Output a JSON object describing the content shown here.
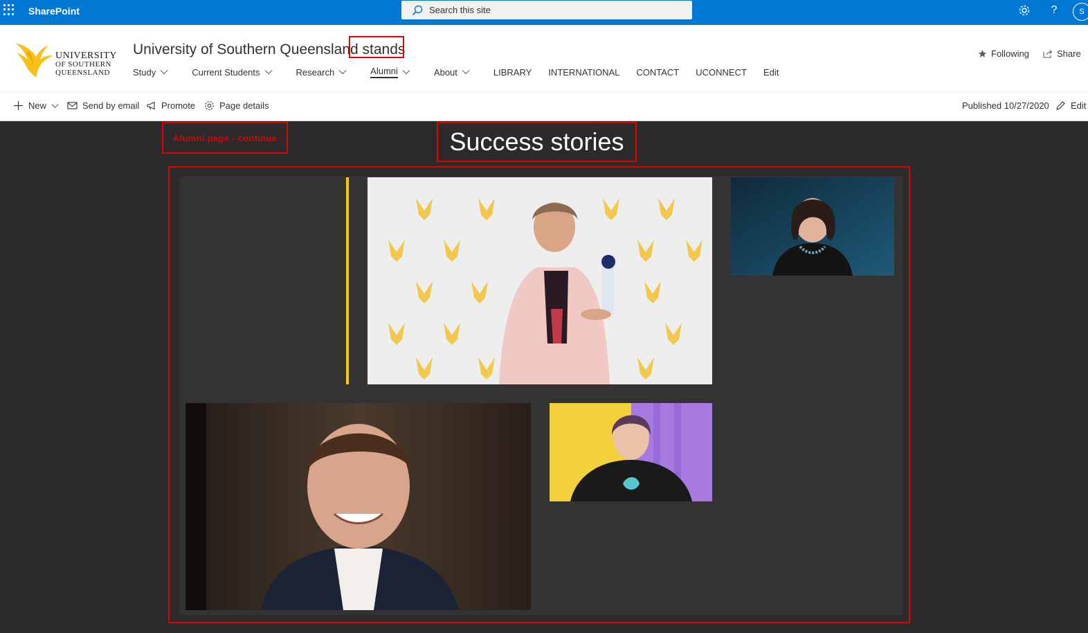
{
  "suite": {
    "brand": "SharePoint",
    "search_placeholder": "Search this site",
    "avatar_initial": "S"
  },
  "site": {
    "logo": {
      "line1": "UNIVERSITY",
      "line2": "OF SOUTHERN",
      "line3": "QUEENSLAND"
    },
    "title": "University of Southern Queensland stands",
    "nav": [
      {
        "label": "Study",
        "dropdown": true
      },
      {
        "label": "Current Students",
        "dropdown": true
      },
      {
        "label": "Research",
        "dropdown": true
      },
      {
        "label": "Alumni",
        "dropdown": true,
        "active": true
      },
      {
        "label": "About",
        "dropdown": true
      },
      {
        "label": "LIBRARY",
        "dropdown": false
      },
      {
        "label": "INTERNATIONAL",
        "dropdown": false
      },
      {
        "label": "CONTACT",
        "dropdown": false
      },
      {
        "label": "UCONNECT",
        "dropdown": false
      },
      {
        "label": "Edit",
        "dropdown": false
      }
    ],
    "following_label": "Following",
    "share_label": "Share"
  },
  "commandbar": {
    "new_label": "New",
    "send_email_label": "Send by email",
    "promote_label": "Promote",
    "page_details_label": "Page details",
    "published_label": "Published 10/27/2020",
    "edit_label": "Edit"
  },
  "canvas": {
    "note": "Alumni page - continue",
    "heading": "Success stories"
  },
  "colors": {
    "suitebar": "#0078d4",
    "accent": "#ffcb05",
    "annotation": "#e00000",
    "canvas": "#2b2b2b"
  },
  "icons": [
    "waffle-icon",
    "search-icon",
    "settings-icon",
    "help-icon",
    "star-icon",
    "share-icon",
    "plus-icon",
    "mail-icon",
    "megaphone-icon",
    "gear-icon",
    "pencil-icon",
    "chevron-down-icon"
  ]
}
